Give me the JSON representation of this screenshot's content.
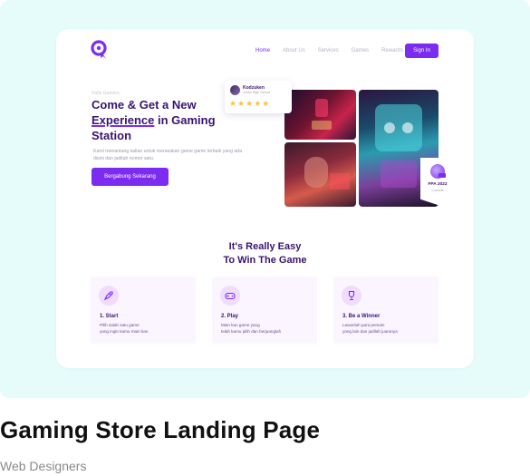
{
  "nav": {
    "items": [
      "Home",
      "About Us",
      "Services",
      "Games",
      "Rewards"
    ],
    "active": "Home",
    "signin_label": "Sign In"
  },
  "hero": {
    "eyebrow": "Hallo Gamers,",
    "title_part1": "Come & Get a New",
    "title_underlined": "Experience",
    "title_part2": " in Gaming Station",
    "subtitle": "Kami menantang kalian untuk merasakan game game terbaik yang ada disini dan jadilah nomor satu.",
    "cta_label": "Bergabung Sekarang"
  },
  "review": {
    "name": "Kodzuken",
    "school": "Junior High School",
    "stars": "★★★★★",
    "rating": 5
  },
  "award": {
    "title": "FPA 2022",
    "subtitle": "Console"
  },
  "section": {
    "title_line1": "It's Really Easy",
    "title_line2": "To Win The Game"
  },
  "steps": [
    {
      "title": "1. Start",
      "desc_line1": "Pilih salah satu game",
      "desc_line2": "yang ingin kamu main kan",
      "icon": "rocket-icon"
    },
    {
      "title": "2. Play",
      "desc_line1": "Main kan game yang",
      "desc_line2": "telah kamu pilih dan berjuanglah",
      "icon": "gamepad-icon"
    },
    {
      "title": "3. Be a Winner",
      "desc_line1": "Lawanlah para pemain",
      "desc_line2": "yang lain dan jadilah juaranya",
      "icon": "trophy-icon"
    }
  ],
  "caption": {
    "title": "Gaming Store Landing Page",
    "author": "Web Designers"
  },
  "colors": {
    "accent": "#7c2cf0",
    "heading": "#3a1470",
    "background": "#e6fcfb",
    "star": "#f6c544"
  }
}
